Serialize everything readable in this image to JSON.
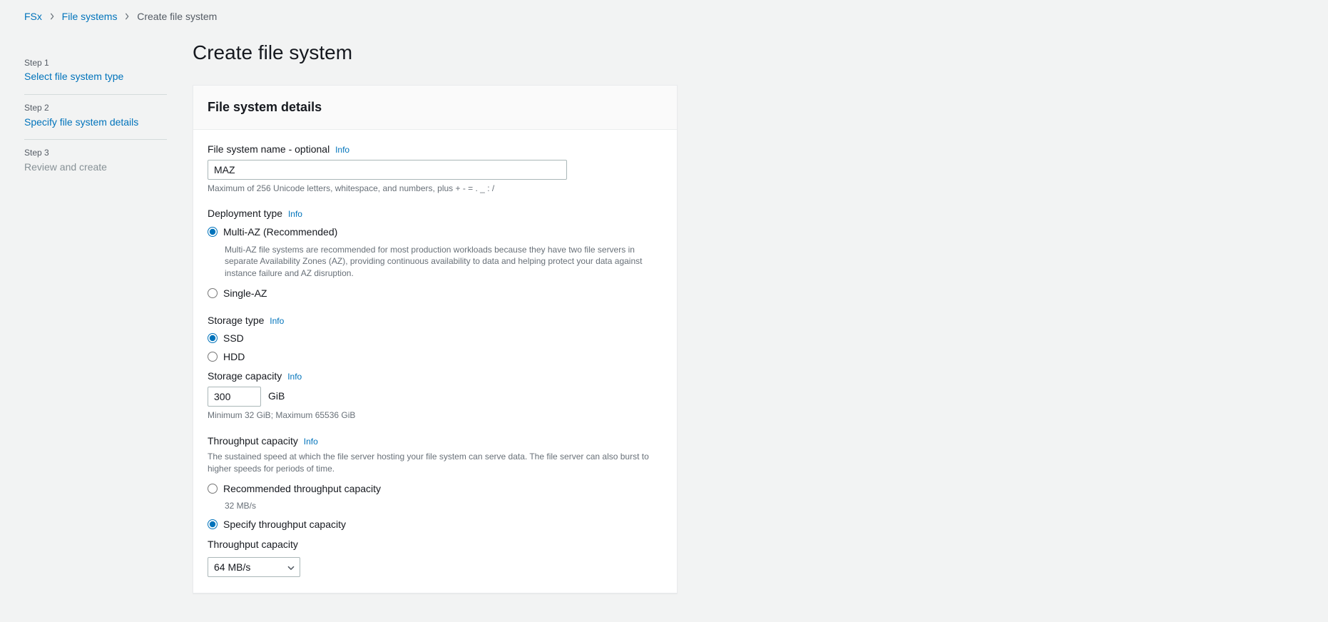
{
  "breadcrumbs": {
    "items": [
      {
        "label": "FSx"
      },
      {
        "label": "File systems"
      },
      {
        "label": "Create file system"
      }
    ]
  },
  "steps": [
    {
      "number": "Step 1",
      "title": "Select file system type",
      "active": true
    },
    {
      "number": "Step 2",
      "title": "Specify file system details",
      "active": true
    },
    {
      "number": "Step 3",
      "title": "Review and create",
      "active": false
    }
  ],
  "page": {
    "title": "Create file system",
    "info_label": "Info"
  },
  "panel": {
    "title": "File system details"
  },
  "name": {
    "label": "File system name - optional",
    "value": "MAZ",
    "hint": "Maximum of 256 Unicode letters, whitespace, and numbers, plus + - = . _ : /"
  },
  "deployment": {
    "label": "Deployment type",
    "options": [
      {
        "label": "Multi-AZ (Recommended)",
        "checked": true,
        "description": "Multi-AZ file systems are recommended for most production workloads because they have two file servers in separate Availability Zones (AZ), providing continuous availability to data and helping protect your data against instance failure and AZ disruption."
      },
      {
        "label": "Single-AZ",
        "checked": false
      }
    ]
  },
  "storage_type": {
    "label": "Storage type",
    "options": [
      {
        "label": "SSD",
        "checked": true
      },
      {
        "label": "HDD",
        "checked": false
      }
    ]
  },
  "storage_capacity": {
    "label": "Storage capacity",
    "value": "300",
    "unit": "GiB",
    "hint": "Minimum 32 GiB; Maximum 65536 GiB"
  },
  "throughput": {
    "label": "Throughput capacity",
    "description": "The sustained speed at which the file server hosting your file system can serve data. The file server can also burst to higher speeds for periods of time.",
    "options": [
      {
        "label": "Recommended throughput capacity",
        "sub": "32 MB/s",
        "checked": false
      },
      {
        "label": "Specify throughput capacity",
        "checked": true
      }
    ],
    "select_label": "Throughput capacity",
    "value": "64 MB/s"
  }
}
